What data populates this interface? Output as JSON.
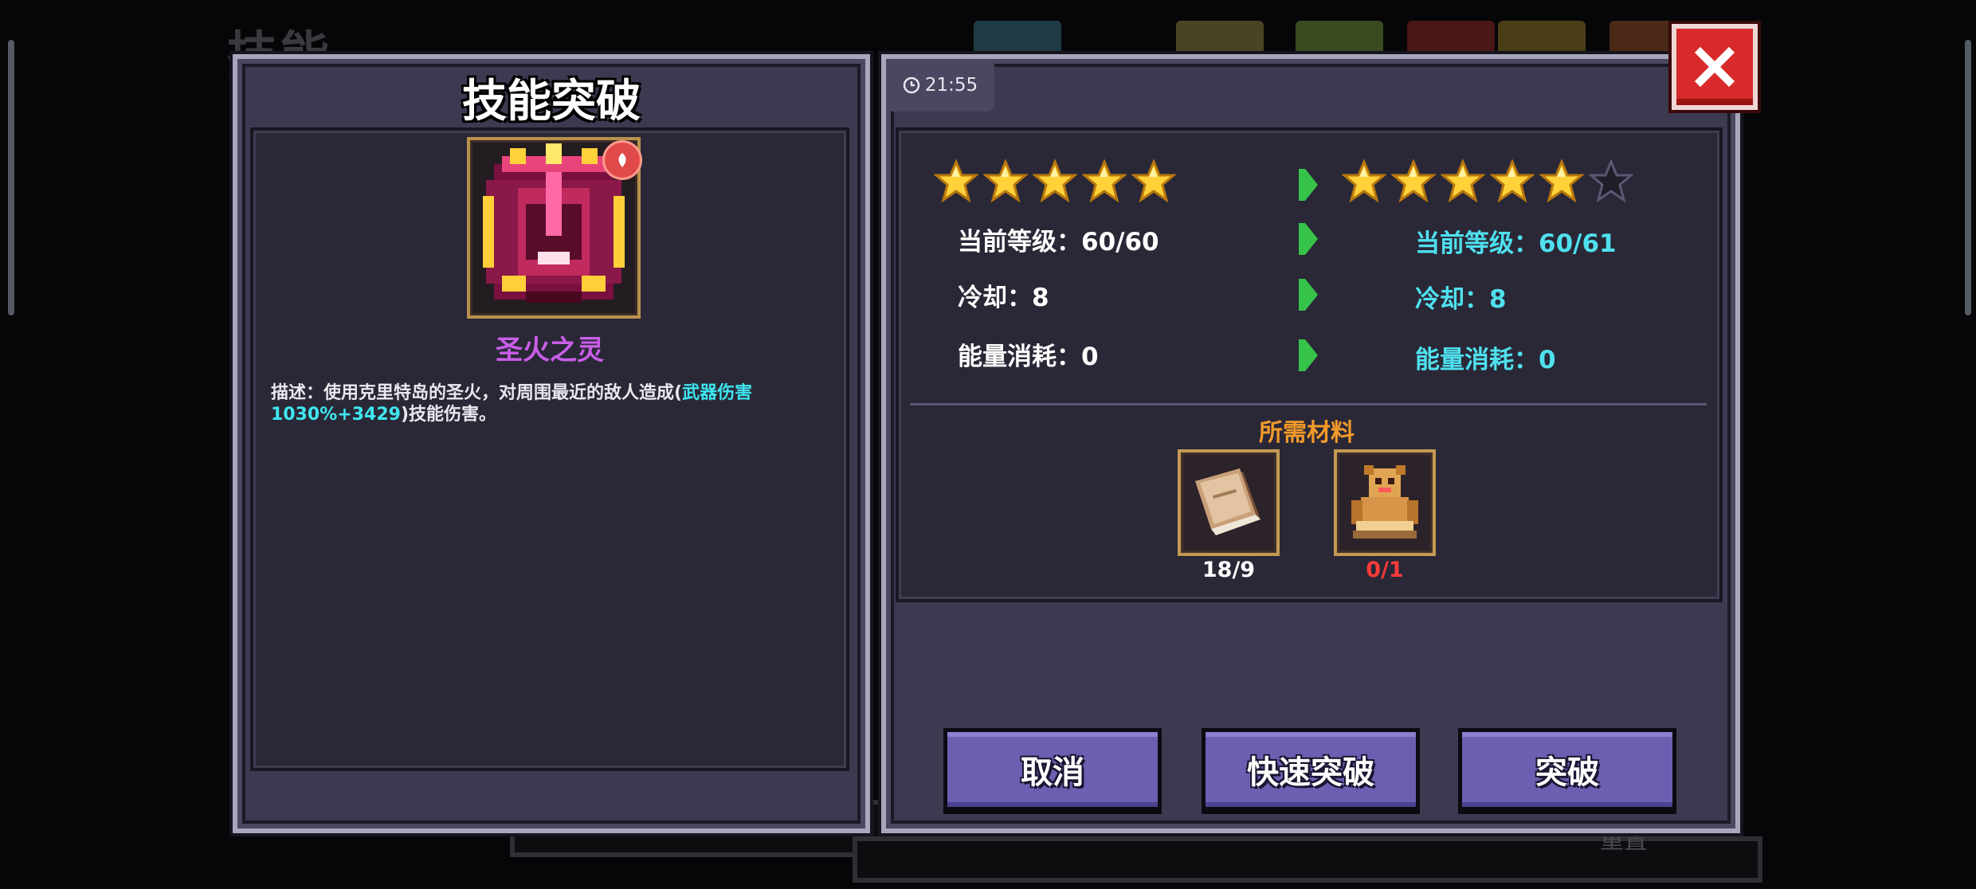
{
  "background": {
    "screen_title": "技能",
    "bottom_button_label": "重置"
  },
  "dialog": {
    "title": "技能突破",
    "time": "21:55"
  },
  "skill": {
    "name": "圣火之灵",
    "name_color": "#c95ee8",
    "description_prefix": "描述：使用克里特岛的圣火，对周围最近的敌人造成(",
    "description_highlight": "武器伤害1030%+3429",
    "description_suffix": ")技能伤害。",
    "highlight_color": "#3ee6ee"
  },
  "current": {
    "stars_filled": 5,
    "stars_total": 5,
    "level": "当前等级：60/60",
    "cooldown": "冷却：8",
    "energy": "能量消耗：0"
  },
  "next": {
    "stars_filled": 5,
    "stars_total": 6,
    "level": "当前等级：60/61",
    "cooldown": "冷却：8",
    "energy": "能量消耗：0",
    "color": "#4fe0ee"
  },
  "materials": {
    "title": "所需材料",
    "items": [
      {
        "icon": "book-icon",
        "count": "18/9",
        "count_color": "#ffffff"
      },
      {
        "icon": "golden-idol-icon",
        "count": "0/1",
        "count_color": "#ff3a3a"
      }
    ]
  },
  "buttons": {
    "cancel": "取消",
    "quick_breakthrough": "快速突破",
    "breakthrough": "突破"
  },
  "colors": {
    "panel": "#3c3950",
    "inner_panel": "#2a2837",
    "button": "#6a5fb0",
    "star": "#ffd23a",
    "arrow": "#37c24a",
    "close": "#d82a2a",
    "materials_title": "#f39a2a"
  }
}
